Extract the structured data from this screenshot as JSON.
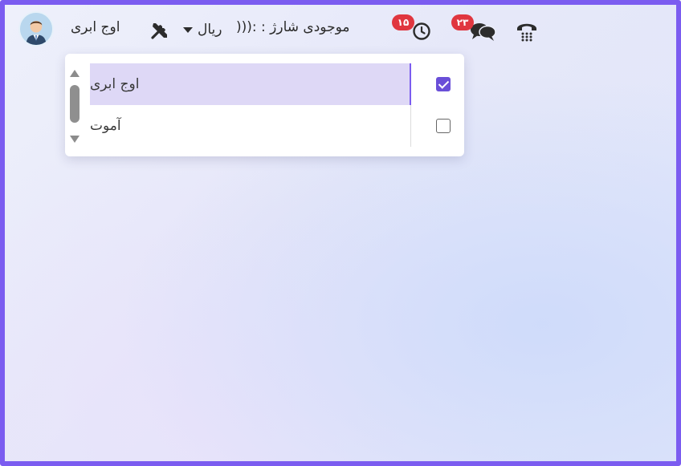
{
  "topbar": {
    "company_name": "اوج ابری",
    "currency_label": "ریال",
    "balance_text": "موجودی شارژ : :(((",
    "activity_badge": "۱۵",
    "messages_badge": "۲۳"
  },
  "dropdown": {
    "options": [
      {
        "label": "اوج ابری",
        "checked": true
      },
      {
        "label": "آموت",
        "checked": false
      }
    ]
  },
  "colors": {
    "accent": "#7b5cf0",
    "selected_row": "#ded8f6",
    "badge": "#e0363f"
  },
  "icons": {
    "avatar": "user-avatar",
    "tools": "wrench-screwdriver-icon",
    "activity": "clock-icon",
    "messages": "chat-bubbles-icon",
    "phone": "phone-icon"
  }
}
